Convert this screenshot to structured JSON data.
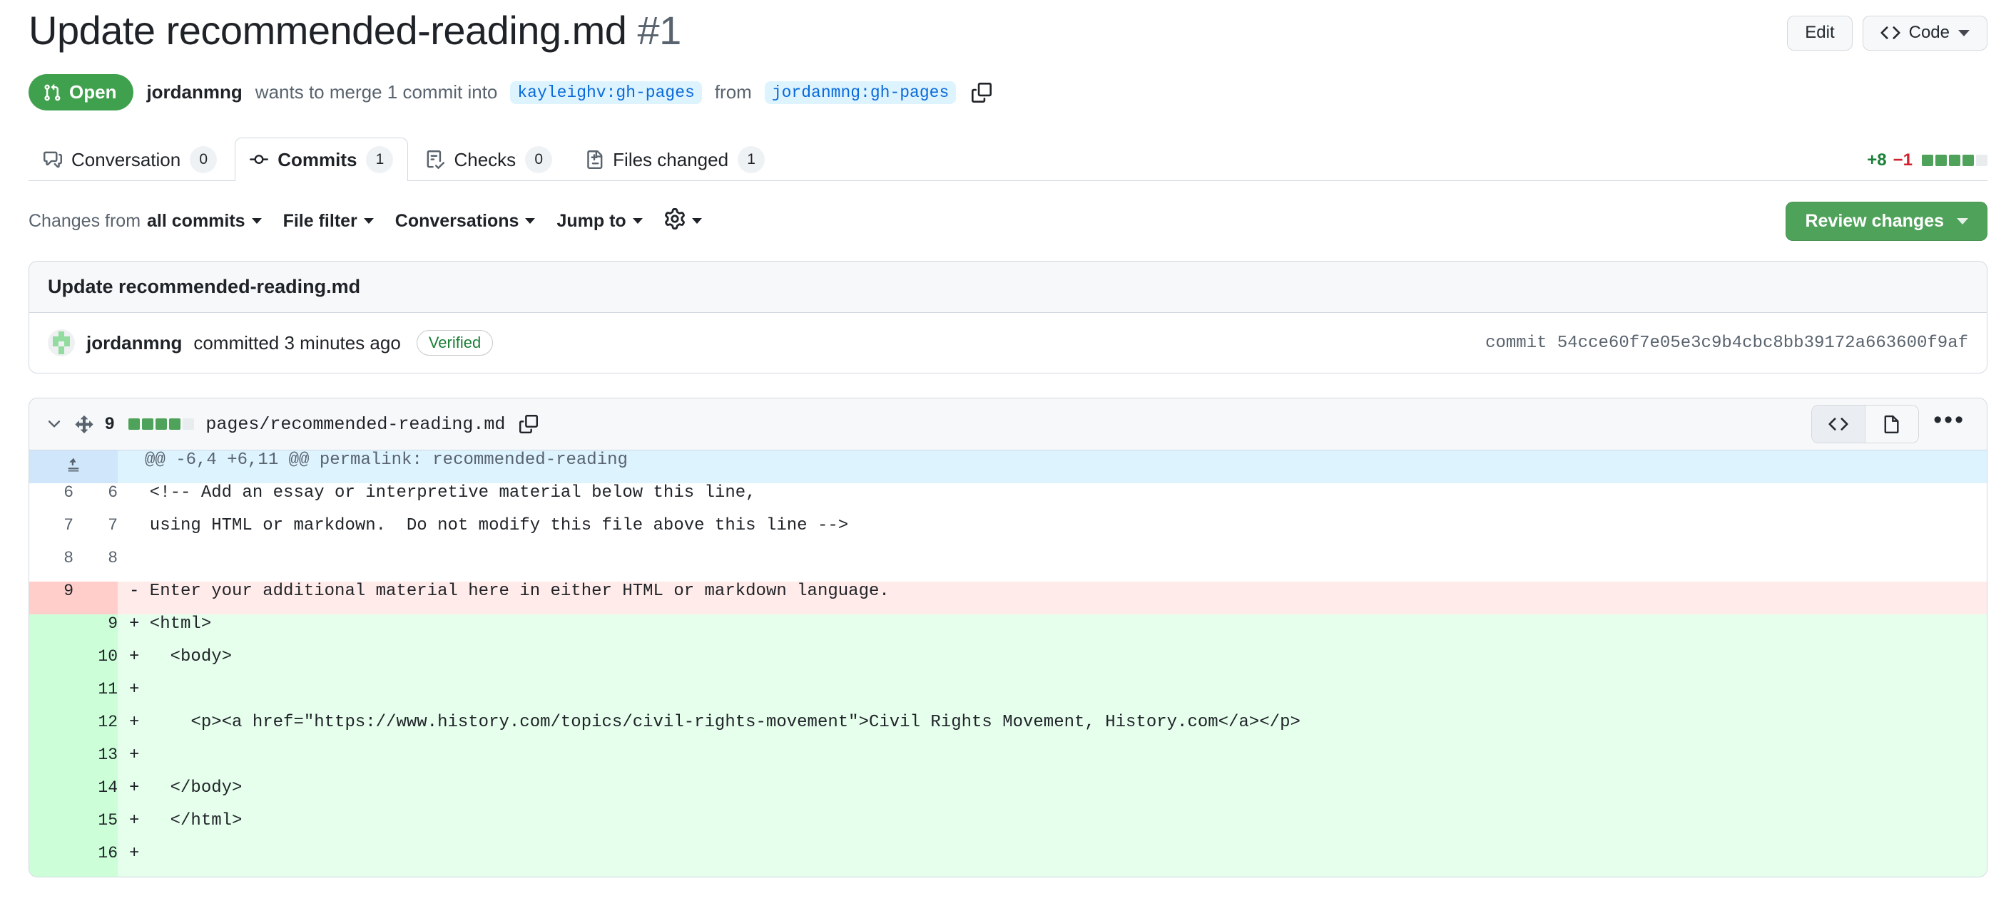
{
  "header": {
    "title": "Update recommended-reading.md",
    "number": "#1",
    "edit_label": "Edit",
    "code_label": "Code"
  },
  "state": {
    "badge": "Open",
    "author": "jordanmng",
    "text_wants": "wants to merge 1 commit into",
    "base_branch": "kayleighv:gh-pages",
    "text_from": "from",
    "head_branch": "jordanmng:gh-pages"
  },
  "tabs": [
    {
      "label": "Conversation",
      "count": "0",
      "icon": "comment-icon",
      "active": false
    },
    {
      "label": "Commits",
      "count": "1",
      "icon": "commit-icon",
      "active": true
    },
    {
      "label": "Checks",
      "count": "0",
      "icon": "checklist-icon",
      "active": false
    },
    {
      "label": "Files changed",
      "count": "1",
      "icon": "file-diff-icon",
      "active": false
    }
  ],
  "diffstat": {
    "additions": "+8",
    "deletions": "−1",
    "blocks_on": 4,
    "blocks_off": 1,
    "add_color": "#1a7f37",
    "del_color": "#cf222e",
    "block_color": "#4fa25a"
  },
  "toolbar": {
    "changes_from_prefix": "Changes from",
    "changes_from_value": "all commits",
    "file_filter": "File filter",
    "conversations": "Conversations",
    "jump_to": "Jump to",
    "settings_icon": "gear-icon",
    "review_changes": "Review changes"
  },
  "commit": {
    "message": "Update recommended-reading.md",
    "author": "jordanmng",
    "action_text": "committed 3 minutes ago",
    "verified": "Verified",
    "sha_label": "commit",
    "sha": "54cce60f7e05e3c9b4cbc8bb39172a663600f9af"
  },
  "file": {
    "change_count": "9",
    "blocks_on": 4,
    "blocks_off": 1,
    "path": "pages/recommended-reading.md",
    "copy_icon": "copy-icon",
    "view_code_icon": "code-view-icon",
    "view_file_icon": "file-view-icon",
    "menu_icon": "kebab-menu-icon"
  },
  "diff": {
    "hunk_header": "@@ -6,4 +6,11 @@ permalink: recommended-reading",
    "rows": [
      {
        "type": "ctx",
        "old": "6",
        "new": "6",
        "code": "  <!-- Add an essay or interpretive material below this line,"
      },
      {
        "type": "ctx",
        "old": "7",
        "new": "7",
        "code": "  using HTML or markdown.  Do not modify this file above this line -->"
      },
      {
        "type": "ctx",
        "old": "8",
        "new": "8",
        "code": ""
      },
      {
        "type": "del",
        "old": "9",
        "new": "",
        "code": "- Enter your additional material here in either HTML or markdown language."
      },
      {
        "type": "add",
        "old": "",
        "new": "9",
        "code": "+ <html>"
      },
      {
        "type": "add",
        "old": "",
        "new": "10",
        "code": "+   <body>"
      },
      {
        "type": "add",
        "old": "",
        "new": "11",
        "code": "+"
      },
      {
        "type": "add",
        "old": "",
        "new": "12",
        "code": "+     <p><a href=\"https://www.history.com/topics/civil-rights-movement\">Civil Rights Movement, History.com</a></p>"
      },
      {
        "type": "add",
        "old": "",
        "new": "13",
        "code": "+"
      },
      {
        "type": "add",
        "old": "",
        "new": "14",
        "code": "+   </body>"
      },
      {
        "type": "add",
        "old": "",
        "new": "15",
        "code": "+   </html>"
      },
      {
        "type": "add",
        "old": "",
        "new": "16",
        "code": "+"
      }
    ]
  }
}
